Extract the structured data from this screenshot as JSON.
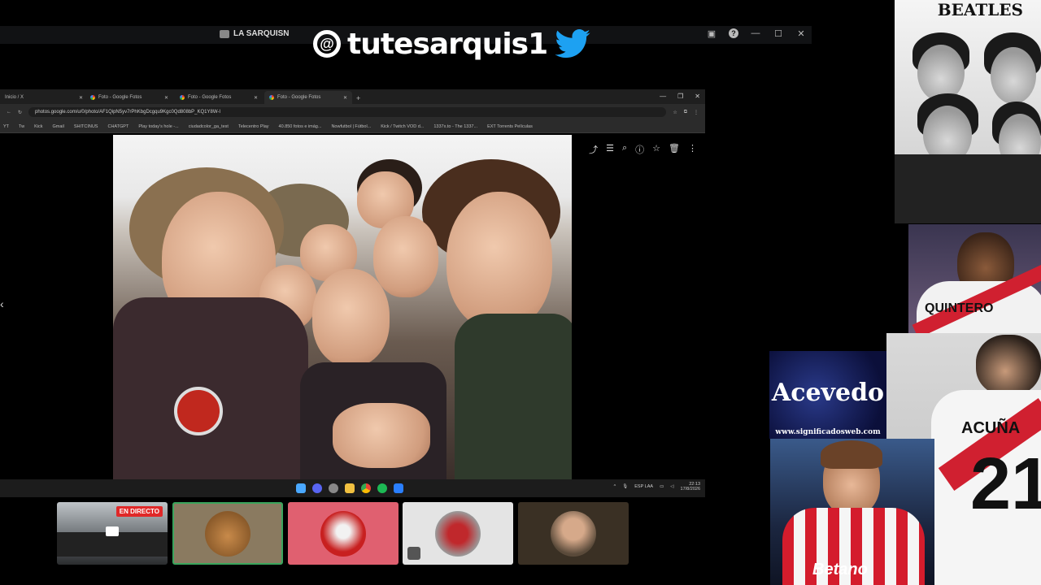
{
  "topbar": {
    "server_name": "LA SARQUISN"
  },
  "overlay": {
    "handle": "tutesarquis1",
    "handle_prefix": "@"
  },
  "browser": {
    "tabs": [
      {
        "label": "Inicio / X"
      },
      {
        "label": "Foto - Google Fotos"
      },
      {
        "label": "Foto - Google Fotos"
      },
      {
        "label": "Foto - Google Fotos"
      }
    ],
    "url": "photos.google.com/u/0/photo/AF1QipN5yv7rPhKbgDcgqu9Kgc0Qd808bP_KQ1Y8W-I",
    "bookmarks": [
      "YT",
      "Tw",
      "Kick",
      "Gmail",
      "SHITCINUS",
      "CHATGPT",
      "Play today's hole -...",
      "ciudadcolor_ga_test",
      "Telecentro Play",
      "40.850 fotos e imág...",
      "Nowfutbol | Fútbol...",
      "Kick / Twitch VOD d...",
      "1337x.to - The 1337...",
      "EXT Torrents Películas"
    ]
  },
  "taskbar": {
    "lang": "ESP\nLAA",
    "time": "22:13",
    "date": "17/8/2026"
  },
  "participants": {
    "live_label": "EN DIRECTO"
  },
  "side": {
    "beatles_title": "BEATLES",
    "player1_name": "QUINTERO",
    "player2_name": "ACUÑA",
    "player2_number": "21",
    "acevedo_title": "Acevedo",
    "acevedo_site": "www.significadosweb.com",
    "sponsor": "Betano"
  },
  "colors": {
    "live_red": "#e02828",
    "tile_pink": "#e06070",
    "tile_green_border": "#3aa55c",
    "twitter_blue": "#1da1f2"
  }
}
